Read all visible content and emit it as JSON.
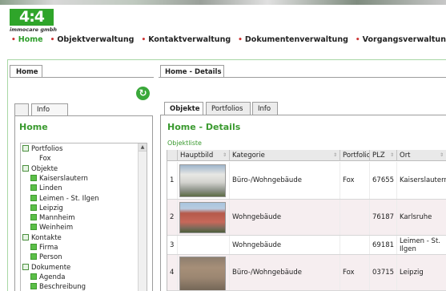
{
  "brand": {
    "logo_text": "4:4",
    "logo_sub": "immocare gmbh",
    "accent": "#2fa52a",
    "title_color": "#3a9a2f"
  },
  "nav": [
    {
      "label": "Home",
      "active": true
    },
    {
      "label": "Objektverwaltung",
      "active": false
    },
    {
      "label": "Kontaktverwaltung",
      "active": false
    },
    {
      "label": "Dokumentenverwaltung",
      "active": false
    },
    {
      "label": "Vorgangsverwaltung",
      "active": false
    }
  ],
  "left": {
    "outer_tab": "Home",
    "refresh_icon": "refresh-icon",
    "tabs": [
      "",
      "Info"
    ],
    "title": "Home",
    "tree": [
      {
        "label": "Portfolios",
        "level": 0,
        "icon": "minus"
      },
      {
        "label": "Fox",
        "level": 1,
        "icon": "none"
      },
      {
        "label": "Objekte",
        "level": 0,
        "icon": "minus"
      },
      {
        "label": "Kaiserslautern",
        "level": 1,
        "icon": "plus"
      },
      {
        "label": "Linden",
        "level": 1,
        "icon": "plus"
      },
      {
        "label": "Leimen - St. Ilgen",
        "level": 1,
        "icon": "plus"
      },
      {
        "label": "Leipzig",
        "level": 1,
        "icon": "plus"
      },
      {
        "label": "Mannheim",
        "level": 1,
        "icon": "plus"
      },
      {
        "label": "Weinheim",
        "level": 1,
        "icon": "plus"
      },
      {
        "label": "Kontakte",
        "level": 0,
        "icon": "minus"
      },
      {
        "label": "Firma",
        "level": 1,
        "icon": "plus"
      },
      {
        "label": "Person",
        "level": 1,
        "icon": "plus"
      },
      {
        "label": "Dokumente",
        "level": 0,
        "icon": "minus"
      },
      {
        "label": "Agenda",
        "level": 1,
        "icon": "plus"
      },
      {
        "label": "Beschreibung",
        "level": 1,
        "icon": "plus"
      }
    ]
  },
  "right": {
    "outer_tab": "Home - Details",
    "tabs": [
      {
        "label": "Objekte",
        "active": true
      },
      {
        "label": "Portfolios",
        "active": false
      },
      {
        "label": "Info",
        "active": false
      }
    ],
    "title": "Home - Details",
    "list_label": "Objektliste",
    "columns": [
      "",
      "Hauptbild",
      "Kategorie",
      "Portfolio",
      "PLZ",
      "Ort"
    ],
    "rows": [
      {
        "nr": "1",
        "has_photo": true,
        "kategorie": "Büro-/Wohngebäude",
        "portfolio": "Fox",
        "plz": "67655",
        "ort": "Kaiserslautern",
        "photo": "white-office-building"
      },
      {
        "nr": "2",
        "has_photo": true,
        "kategorie": "Wohngebäude",
        "portfolio": "",
        "plz": "76187",
        "ort": "Karlsruhe",
        "photo": "red-apartment-house"
      },
      {
        "nr": "3",
        "has_photo": false,
        "kategorie": "Wohngebäude",
        "portfolio": "",
        "plz": "69181",
        "ort": "Leimen - St. Ilgen",
        "photo": ""
      },
      {
        "nr": "4",
        "has_photo": true,
        "kategorie": "Büro-/Wohngebäude",
        "portfolio": "Fox",
        "plz": "03715",
        "ort": "Leipzig",
        "photo": "brick-townhouse"
      }
    ]
  }
}
